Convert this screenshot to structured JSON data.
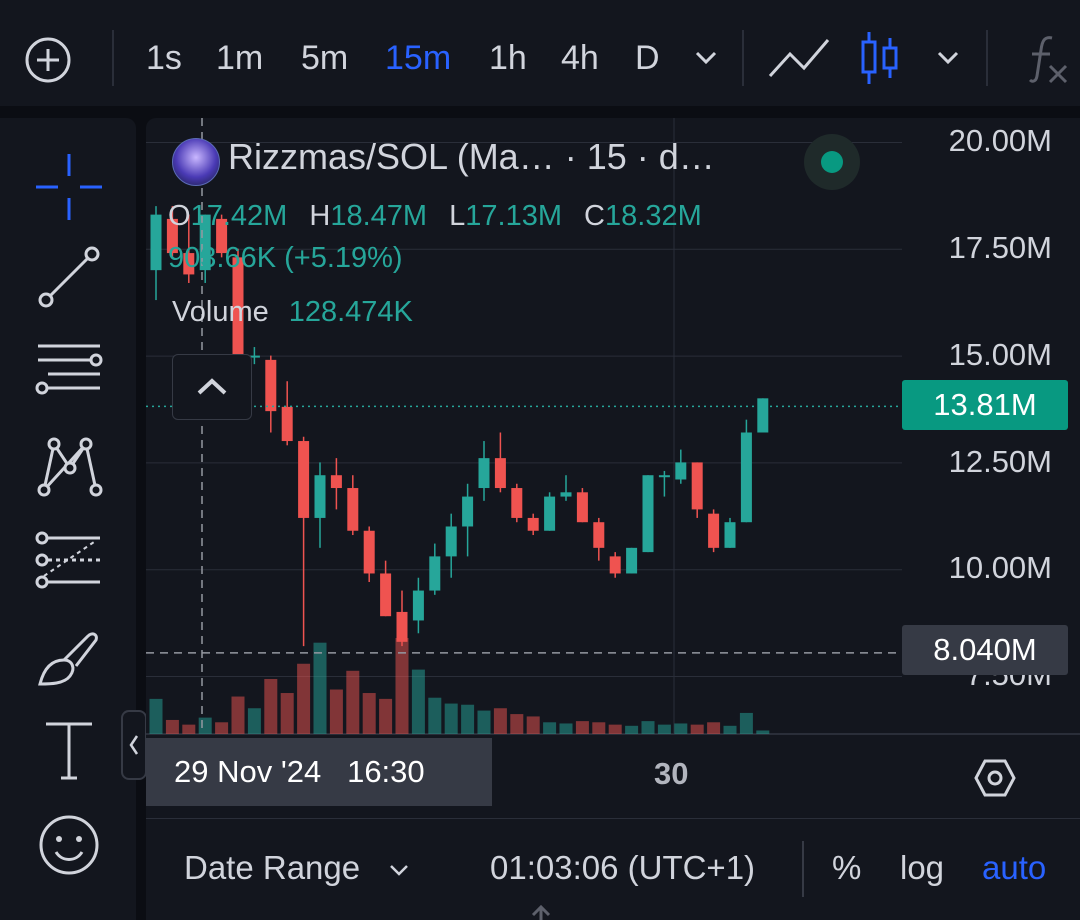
{
  "toolbar": {
    "intervals": [
      "1s",
      "1m",
      "5m",
      "15m",
      "1h",
      "4h",
      "D"
    ],
    "active_interval": "15m",
    "line_chart_icon": "line-chart-icon",
    "candles_icon": "candles-icon",
    "indicators_icon": "fx-icon"
  },
  "drawing_tools": [
    "crosshair-icon",
    "trend-line-icon",
    "horizontal-lines-icon",
    "pattern-icon",
    "fib-icon",
    "brush-icon",
    "text-icon",
    "emoji-icon"
  ],
  "legend": {
    "title": "Rizzmas/SOL (Ma… · 15 · d…",
    "open_label": "O",
    "open": "17.42M",
    "high_label": "H",
    "high": "18.47M",
    "low_label": "L",
    "low": "17.13M",
    "close_label": "C",
    "close": "18.32M",
    "change": "903.66K (+5.19%)",
    "volume_label": "Volume",
    "volume": "128.474K"
  },
  "price_axis": {
    "labels": [
      "20.00M",
      "17.50M",
      "15.00M",
      "12.50M",
      "10.00M",
      "7.50M"
    ],
    "last_price": "13.81M",
    "crosshair_price": "8.040M"
  },
  "time_axis": {
    "crosshair_time": "29 Nov '24   16:30",
    "labels": [
      "30"
    ]
  },
  "bottom_bar": {
    "date_range": "Date Range",
    "clock": "01:03:06 (UTC+1)",
    "percent": "%",
    "log": "log",
    "auto": "auto"
  },
  "colors": {
    "up": "#26a69a",
    "down": "#ef5350",
    "accent": "#2962ff",
    "last_price_tag": "#089981"
  },
  "chart_data": {
    "type": "candlestick",
    "interval": "15m",
    "ylim": [
      7.5,
      20.0
    ],
    "yticks": [
      20.0,
      17.5,
      15.0,
      12.5,
      10.0,
      7.5
    ],
    "candles": [
      {
        "o": 17.0,
        "h": 18.5,
        "l": 16.3,
        "c": 18.3
      },
      {
        "o": 18.2,
        "h": 18.5,
        "l": 17.3,
        "c": 17.4
      },
      {
        "o": 17.4,
        "h": 18.3,
        "l": 16.7,
        "c": 16.9
      },
      {
        "o": 17.0,
        "h": 18.3,
        "l": 16.7,
        "c": 18.3
      },
      {
        "o": 18.2,
        "h": 18.3,
        "l": 17.3,
        "c": 17.4
      },
      {
        "o": 17.3,
        "h": 17.5,
        "l": 14.9,
        "c": 15.0
      },
      {
        "o": 15.0,
        "h": 15.2,
        "l": 14.8,
        "c": 15.0
      },
      {
        "o": 14.9,
        "h": 15.0,
        "l": 13.2,
        "c": 13.7
      },
      {
        "o": 13.8,
        "h": 14.4,
        "l": 12.9,
        "c": 13.0
      },
      {
        "o": 13.0,
        "h": 13.1,
        "l": 8.2,
        "c": 11.2
      },
      {
        "o": 11.2,
        "h": 12.5,
        "l": 10.5,
        "c": 12.2
      },
      {
        "o": 12.2,
        "h": 12.6,
        "l": 11.4,
        "c": 11.9
      },
      {
        "o": 11.9,
        "h": 12.2,
        "l": 10.8,
        "c": 10.9
      },
      {
        "o": 10.9,
        "h": 11.0,
        "l": 9.7,
        "c": 9.9
      },
      {
        "o": 9.9,
        "h": 10.2,
        "l": 8.9,
        "c": 8.9
      },
      {
        "o": 9.0,
        "h": 9.5,
        "l": 8.2,
        "c": 8.3
      },
      {
        "o": 8.8,
        "h": 9.8,
        "l": 8.5,
        "c": 9.5
      },
      {
        "o": 9.5,
        "h": 10.6,
        "l": 9.4,
        "c": 10.3
      },
      {
        "o": 10.3,
        "h": 11.3,
        "l": 9.8,
        "c": 11.0
      },
      {
        "o": 11.0,
        "h": 12.0,
        "l": 10.3,
        "c": 11.7
      },
      {
        "o": 11.9,
        "h": 13.0,
        "l": 11.6,
        "c": 12.6
      },
      {
        "o": 12.6,
        "h": 13.2,
        "l": 11.8,
        "c": 11.9
      },
      {
        "o": 11.9,
        "h": 12.0,
        "l": 11.1,
        "c": 11.2
      },
      {
        "o": 11.2,
        "h": 11.3,
        "l": 10.8,
        "c": 10.9
      },
      {
        "o": 10.9,
        "h": 11.8,
        "l": 10.9,
        "c": 11.7
      },
      {
        "o": 11.7,
        "h": 12.2,
        "l": 11.6,
        "c": 11.8
      },
      {
        "o": 11.8,
        "h": 11.9,
        "l": 11.1,
        "c": 11.1
      },
      {
        "o": 11.1,
        "h": 11.2,
        "l": 10.2,
        "c": 10.5
      },
      {
        "o": 10.3,
        "h": 10.4,
        "l": 9.8,
        "c": 9.9
      },
      {
        "o": 9.9,
        "h": 10.5,
        "l": 9.9,
        "c": 10.5
      },
      {
        "o": 10.4,
        "h": 12.2,
        "l": 10.4,
        "c": 12.2
      },
      {
        "o": 12.2,
        "h": 12.3,
        "l": 11.7,
        "c": 12.2
      },
      {
        "o": 12.1,
        "h": 12.8,
        "l": 12.0,
        "c": 12.5
      },
      {
        "o": 12.5,
        "h": 12.5,
        "l": 11.2,
        "c": 11.4
      },
      {
        "o": 11.3,
        "h": 11.4,
        "l": 10.4,
        "c": 10.5
      },
      {
        "o": 10.5,
        "h": 11.2,
        "l": 10.5,
        "c": 11.1
      },
      {
        "o": 11.1,
        "h": 13.5,
        "l": 11.1,
        "c": 13.2
      },
      {
        "o": 13.2,
        "h": 14.0,
        "l": 13.2,
        "c": 14.0
      }
    ],
    "volumes": [
      30,
      12,
      8,
      14,
      10,
      32,
      22,
      47,
      35,
      60,
      78,
      38,
      54,
      35,
      30,
      82,
      55,
      31,
      26,
      25,
      20,
      22,
      17,
      15,
      10,
      9,
      11,
      10,
      8,
      7,
      11,
      8,
      9,
      8,
      10,
      7,
      18,
      3
    ],
    "volume_up": [
      true,
      false,
      false,
      true,
      false,
      false,
      true,
      false,
      false,
      false,
      true,
      false,
      false,
      false,
      false,
      false,
      true,
      true,
      true,
      true,
      true,
      false,
      false,
      false,
      true,
      true,
      false,
      false,
      false,
      true,
      true,
      true,
      true,
      false,
      false,
      true,
      true,
      true
    ]
  }
}
